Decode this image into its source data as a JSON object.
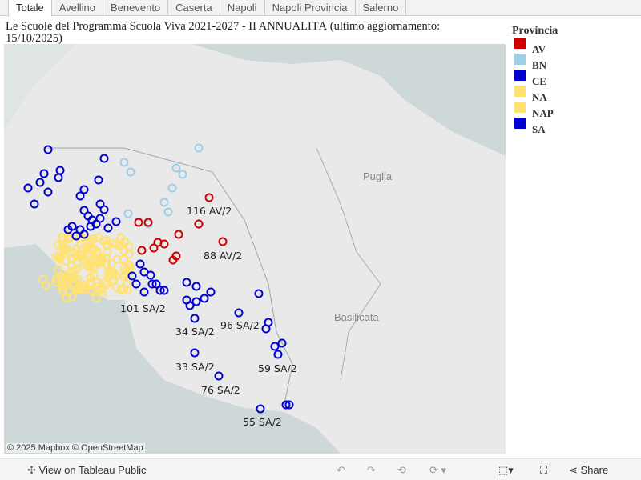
{
  "tabs": [
    "Totale",
    "Avellino",
    "Benevento",
    "Caserta",
    "Napoli",
    "Napoli Provincia",
    "Salerno"
  ],
  "active_tab": "Totale",
  "title": "Le Scuole del Programma Scuola Viva 2021-2027 - II ANNUALITÀ (ultimo aggiornamento: 15/10/2025)",
  "legend": {
    "title": "Provincia",
    "items": [
      {
        "label": "AV",
        "color": "#cc0000"
      },
      {
        "label": "BN",
        "color": "#9ecfe6"
      },
      {
        "label": "CE",
        "color": "#0000cc"
      },
      {
        "label": "NA",
        "color": "#ffe270"
      },
      {
        "label": "NAP",
        "color": "#ffe270"
      },
      {
        "label": "SA",
        "color": "#0000cc"
      }
    ]
  },
  "map": {
    "regions": [
      "Puglia",
      "Basilicata"
    ],
    "annotations": [
      "116 AV/2",
      "88 AV/2",
      "101 SA/2",
      "34 SA/2",
      "96 SA/2",
      "33 SA/2",
      "59 SA/2",
      "76 SA/2",
      "55 SA/2"
    ],
    "attribution": "© 2025 Mapbox © OpenStreetMap"
  },
  "footer": {
    "view_label": "View on Tableau Public",
    "share_label": "Share"
  }
}
